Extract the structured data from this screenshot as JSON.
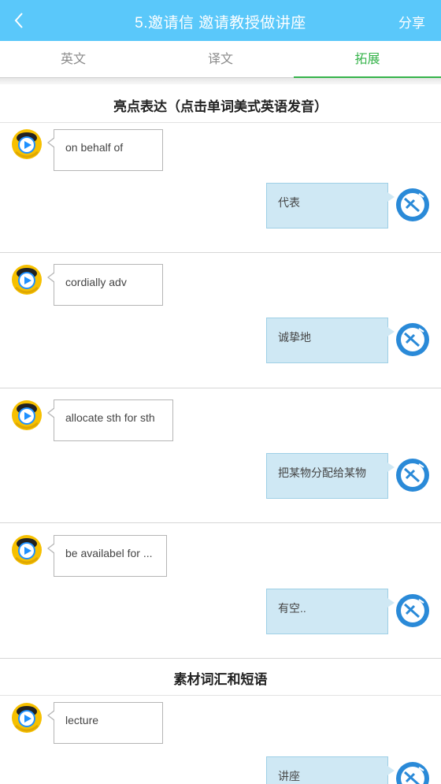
{
  "header": {
    "title": "5.邀请信  邀请教授做讲座",
    "share_label": "分享",
    "background_color": "#5ac8fa"
  },
  "tabs": [
    {
      "label": "英文",
      "active": false
    },
    {
      "label": "译文",
      "active": false
    },
    {
      "label": "拓展",
      "active": true
    }
  ],
  "accent_color": "#35b34a",
  "sections": [
    {
      "title": "亮点表达（点击单词美式英语发音）",
      "items": [
        {
          "en": "on behalf of",
          "cn": "代表"
        },
        {
          "en": "cordially adv",
          "cn": "诚挚地"
        },
        {
          "en": "allocate sth for sth",
          "cn": "把某物分配给某物"
        },
        {
          "en": "be availabel for ...",
          "cn": "有空.."
        }
      ]
    },
    {
      "title": "素材词汇和短语",
      "items": [
        {
          "en": "lecture",
          "cn": "讲座"
        }
      ]
    }
  ],
  "icons": {
    "back": "chevron-left-icon",
    "speaker_avatar": "play-avatar-icon",
    "logo_avatar": "school-logo-icon"
  }
}
